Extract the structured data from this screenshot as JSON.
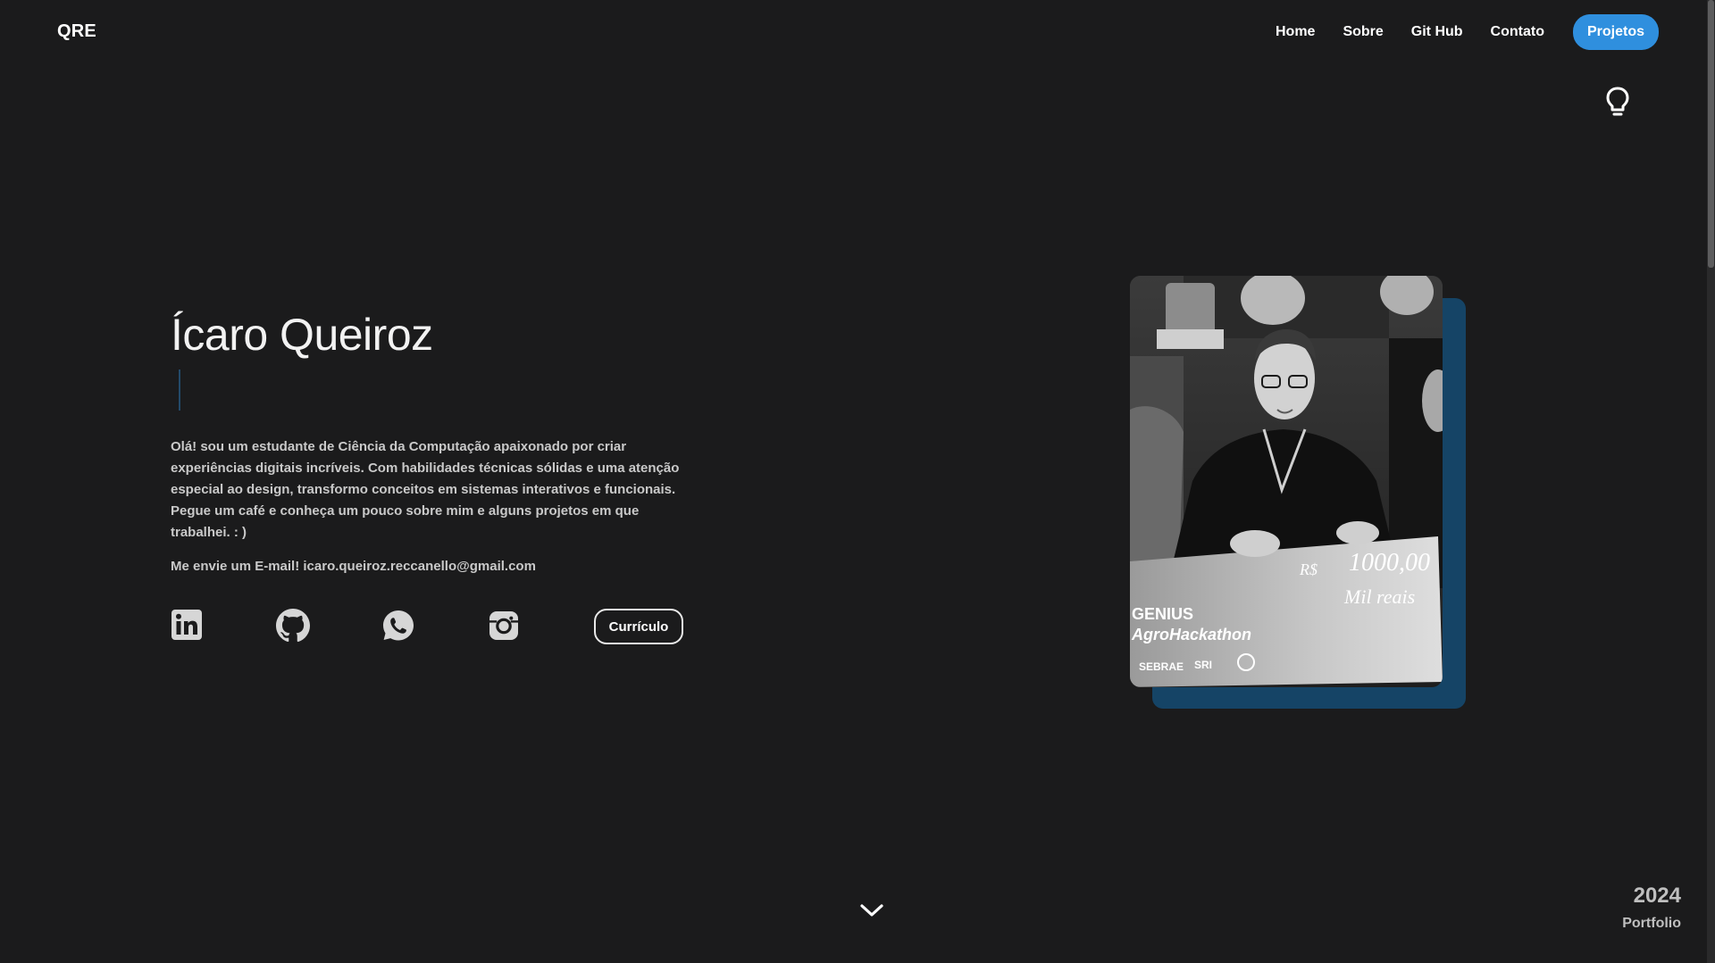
{
  "header": {
    "logo": "QRE",
    "nav": {
      "home": "Home",
      "about": "Sobre",
      "github": "Git Hub",
      "contact": "Contato",
      "projects": "Projetos"
    },
    "theme_toggle_icon": "lightbulb-icon"
  },
  "hero": {
    "name": "Ícaro Queiroz",
    "bio": "Olá! sou um estudante de Ciência da Computação apaixonado por criar experiências digitais incríveis. Com habilidades técnicas sólidas e uma atenção especial ao design, transformo conceitos em sistemas interativos e funcionais. Pegue um café e conheça um pouco sobre mim e alguns projetos em que trabalhei. : )",
    "email_line": "Me envie um E-mail! icaro.queiroz.reccanello@gmail.com",
    "socials": [
      "linkedin-icon",
      "github-icon",
      "whatsapp-icon",
      "instagram-icon"
    ],
    "resume_button": "Currículo"
  },
  "photo": {
    "check_amount": "R$ 1000,00",
    "check_words": "Mil reais",
    "event_logo_lines": [
      "GENIUS",
      "AgroHackathon"
    ],
    "sponsors": [
      "SEBRAE",
      "SRI"
    ]
  },
  "footer": {
    "year": "2024",
    "label": "Portfolio",
    "scroll_icon": "chevron-down-icon"
  },
  "colors": {
    "background": "#1b1b1c",
    "accent": "#2f8fde",
    "photo_shadow": "#154466"
  }
}
